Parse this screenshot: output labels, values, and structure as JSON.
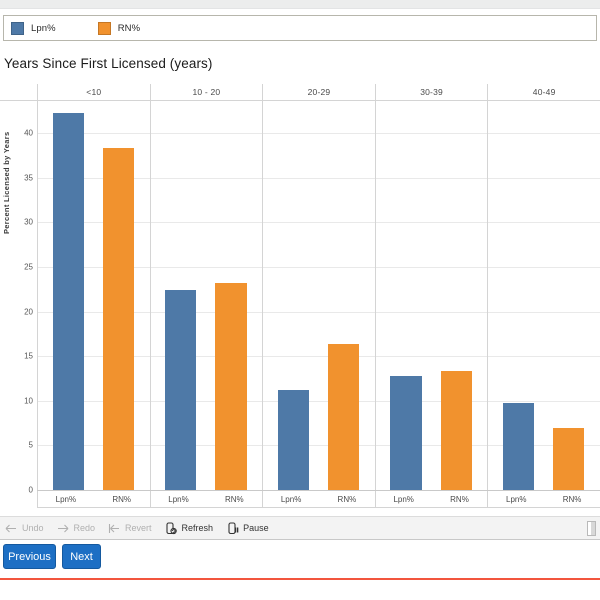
{
  "legend": {
    "items": [
      {
        "label": "Lpn%",
        "color": "#4E79A7",
        "icon": "legend-swatch-blue"
      },
      {
        "label": "RN%",
        "color": "#F1922E",
        "icon": "legend-swatch-orange"
      }
    ]
  },
  "chart_data": {
    "type": "bar",
    "title": "Years Since First Licensed (years)",
    "xlabel": "",
    "ylabel": "Percent Licensed by Years",
    "categories": [
      "<10",
      "10 - 20",
      "20-29",
      "30-39",
      "40-49"
    ],
    "series": [
      {
        "name": "Lpn%",
        "color": "#4E79A7",
        "values": [
          42.3,
          22.4,
          11.2,
          12.8,
          9.8
        ]
      },
      {
        "name": "RN%",
        "color": "#F1922E",
        "values": [
          38.3,
          23.2,
          16.4,
          13.3,
          7.0
        ]
      }
    ],
    "ylim": [
      0,
      43.5
    ],
    "yticks": [
      0,
      5,
      10,
      15,
      20,
      25,
      30,
      35,
      40
    ],
    "ytick_labels": [
      "0",
      "5",
      "10",
      "15",
      "20",
      "25",
      "30",
      "35",
      "40"
    ],
    "bar_labels": [
      "Lpn%",
      "RN%"
    ],
    "grid": true,
    "legend_position": "top"
  },
  "toolbar": {
    "items": [
      {
        "label": "Undo",
        "icon": "arrow-left-icon",
        "enabled": false
      },
      {
        "label": "Redo",
        "icon": "arrow-right-icon",
        "enabled": false
      },
      {
        "label": "Revert",
        "icon": "revert-arrow-icon",
        "enabled": false
      },
      {
        "label": "Refresh",
        "icon": "refresh-icon",
        "enabled": true
      },
      {
        "label": "Pause",
        "icon": "pause-icon",
        "enabled": true
      }
    ]
  },
  "navigation": {
    "previous_label": "Previous",
    "next_label": "Next",
    "accent_color": "#1D6FC4"
  }
}
